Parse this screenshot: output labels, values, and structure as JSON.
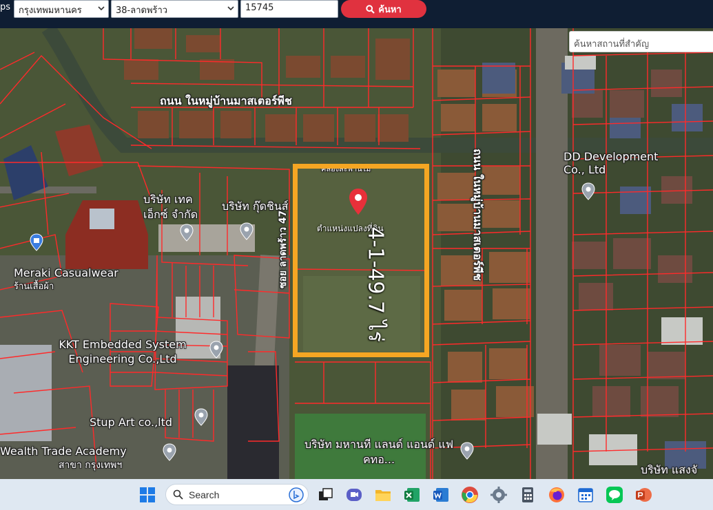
{
  "toolbar": {
    "prefix": "ps",
    "province": "กรุงเทพมหานคร",
    "district": "38-ลาดพร้าว",
    "parcel_number": "15745",
    "search_label": "ค้นหา"
  },
  "map": {
    "place_search_placeholder": "ค้นหาสถานที่สำคัญ",
    "road_label_top": "ถนน ในหมู่บ้านมาสเตอร์พีช",
    "road_label_right": "ถนน ในหมู่บ้านมาสเตอร์พีช",
    "road_label_soi": "ซอย ลาดพร้าว 47",
    "canal_label": "คลองสะพานไม้",
    "parcel_caption": "ตำแหน่งแปลงที่ดิน",
    "parcel_area": "4-1-49.7 ไร่",
    "places": {
      "dd_development": "DD Development Co., Ltd",
      "tech_company": "บริษัท เทค เอ็กซ์ จำกัด",
      "kudchin_company": "บริษัท กุ๊ดชินส์",
      "meraki": "Meraki Casualwear",
      "meraki_sub": "ร้านเสื้อผ้า",
      "kkt": "KKT Embedded System Engineering Co.,Ltd",
      "stup_art": "Stup Art co.,ltd",
      "wealth_trade": "Wealth Trade Academy",
      "wealth_trade_sub": "สาขา กรุงเทพฯ",
      "mahanakhon_land": "บริษัท มหานที แลนด์ แอนด์ แฟ คทอ...",
      "bottom_right": "บริษัท แสงจั"
    }
  },
  "taskbar": {
    "search_label": "Search",
    "icons": [
      "windows-start-icon",
      "task-view-icon",
      "meet-icon",
      "file-explorer-icon",
      "excel-icon",
      "word-icon",
      "chrome-icon",
      "settings-icon",
      "calculator-icon",
      "firefox-icon",
      "calendar-icon",
      "line-icon",
      "powerpoint-icon"
    ]
  },
  "colors": {
    "topbar": "#0f1e33",
    "search_button": "#e0323f",
    "parcel_highlight": "#f5a623",
    "parcel_lines": "#ff2a2a",
    "pin": "#e8303a",
    "taskbar": "#dfe8f2"
  }
}
